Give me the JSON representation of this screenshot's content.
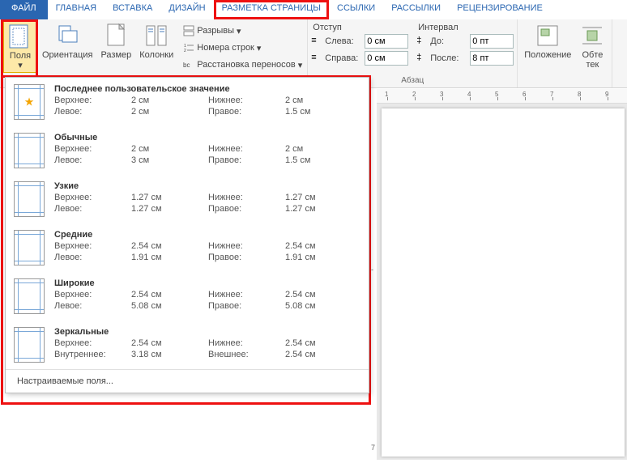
{
  "tabs": {
    "file": "ФАЙЛ",
    "home": "ГЛАВНАЯ",
    "insert": "ВСТАВКА",
    "design": "ДИЗАЙН",
    "layout": "РАЗМЕТКА СТРАНИЦЫ",
    "references": "ССЫЛКИ",
    "mailings": "РАССЫЛКИ",
    "review": "РЕЦЕНЗИРОВАНИЕ"
  },
  "ribbon": {
    "margins": "Поля",
    "orientation": "Ориентация",
    "size": "Размер",
    "columns": "Колонки",
    "breaks": "Разрывы",
    "line_numbers": "Номера строк",
    "hyphenation": "Расстановка переносов",
    "indent_label": "Отступ",
    "interval_label": "Интервал",
    "left": "Слева:",
    "right": "Справа:",
    "before": "До:",
    "after": "После:",
    "left_val": "0 см",
    "right_val": "0 см",
    "before_val": "0 пт",
    "after_val": "8 пт",
    "paragraph_group": "Абзац",
    "position": "Положение",
    "wrap": "Обте",
    "wrap2": "тек",
    "arrow": "▾"
  },
  "dropdown": {
    "labels": {
      "top": "Верхнее:",
      "bottom": "Нижнее:",
      "left": "Левое:",
      "right": "Правое:",
      "inner": "Внутреннее:",
      "outer": "Внешнее:"
    },
    "items": [
      {
        "title": "Последнее пользовательское значение",
        "top": "2 см",
        "bottom": "2 см",
        "left": "2 см",
        "right": "1.5 см",
        "star": true
      },
      {
        "title": "Обычные",
        "top": "2 см",
        "bottom": "2 см",
        "left": "3 см",
        "right": "1.5 см"
      },
      {
        "title": "Узкие",
        "top": "1.27 см",
        "bottom": "1.27 см",
        "left": "1.27 см",
        "right": "1.27 см"
      },
      {
        "title": "Средние",
        "top": "2.54 см",
        "bottom": "2.54 см",
        "left": "1.91 см",
        "right": "1.91 см"
      },
      {
        "title": "Широкие",
        "top": "2.54 см",
        "bottom": "2.54 см",
        "left": "5.08 см",
        "right": "5.08 см"
      },
      {
        "title": "Зеркальные",
        "top": "2.54 см",
        "bottom": "2.54 см",
        "left": "3.18 см",
        "right": "2.54 см",
        "mirror": true
      }
    ],
    "custom": "Настраиваемые поля..."
  },
  "ruler": {
    "marks": [
      "1",
      "2",
      "3",
      "4",
      "5",
      "6",
      "7",
      "8",
      "9"
    ]
  }
}
